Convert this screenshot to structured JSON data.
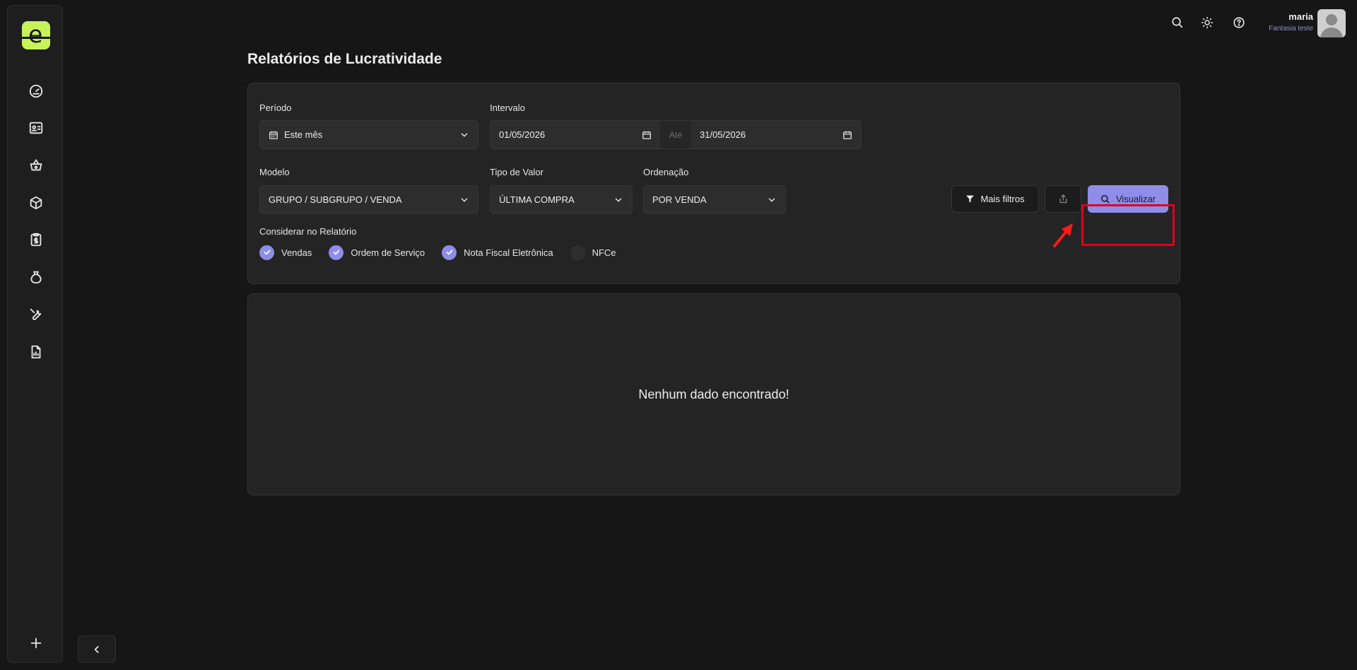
{
  "app": {
    "logo_glyph": "e",
    "accent_color": "#8e8de8",
    "brand_color": "#c8f25a"
  },
  "sidebar": {
    "items": [
      {
        "icon": "dashboard-gauge-icon"
      },
      {
        "icon": "contacts-card-icon"
      },
      {
        "icon": "shopping-basket-icon"
      },
      {
        "icon": "box-package-icon"
      },
      {
        "icon": "clipboard-money-icon"
      },
      {
        "icon": "money-bag-icon"
      },
      {
        "icon": "wrench-tools-icon"
      },
      {
        "icon": "report-chart-file-icon"
      }
    ],
    "add_icon": "plus-icon",
    "collapse_icon": "chevron-left-icon"
  },
  "header": {
    "user_name": "maria",
    "user_company": "Fantasia teste"
  },
  "page": {
    "title": "Relatórios de Lucratividade"
  },
  "filters": {
    "periodo_label": "Período",
    "periodo_value": "Este mês",
    "intervalo_label": "Intervalo",
    "date_start": "01/05/2026",
    "date_sep": "Até",
    "date_end": "31/05/2026",
    "modelo_label": "Modelo",
    "modelo_value": "GRUPO / SUBGRUPO / VENDA",
    "tipo_valor_label": "Tipo de Valor",
    "tipo_valor_value": "ÚLTIMA COMPRA",
    "ordenacao_label": "Ordenação",
    "ordenacao_value": "POR VENDA",
    "considerar_label": "Considerar no Relatório",
    "checkboxes": [
      {
        "label": "Vendas",
        "checked": true
      },
      {
        "label": "Ordem de Serviço",
        "checked": true
      },
      {
        "label": "Nota Fiscal Eletrônica",
        "checked": true
      },
      {
        "label": "NFCe",
        "checked": false
      }
    ],
    "mais_filtros_label": "Mais filtros",
    "visualizar_label": "Visualizar"
  },
  "results": {
    "empty_message": "Nenhum dado encontrado!"
  }
}
